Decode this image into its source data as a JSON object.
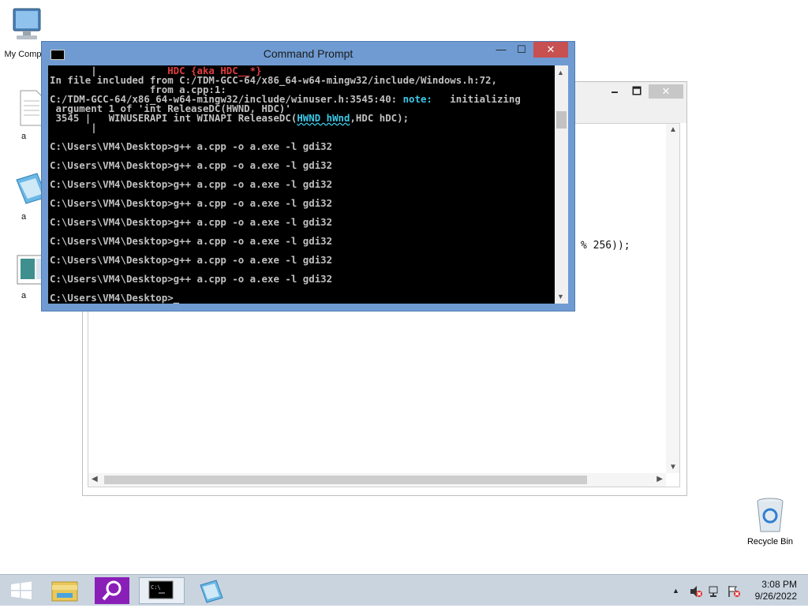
{
  "desktop": {
    "icons": [
      {
        "label": "My Comp",
        "icon": "computer-icon"
      },
      {
        "label": "a",
        "icon": "text-file-icon"
      },
      {
        "label": "a",
        "icon": "notepad-file-icon"
      },
      {
        "label": "a",
        "icon": "image-file-icon"
      }
    ],
    "recycle_bin": {
      "label": "Recycle Bin",
      "icon": "recycle-bin-icon"
    }
  },
  "background_window": {
    "minimize": "🗕",
    "maximize": "🗖",
    "close": "✕",
    "code_fragment": "% 256));"
  },
  "cmd_window": {
    "title": "Command Prompt",
    "minimize": "—",
    "maximize": "☐",
    "close": "✕",
    "lines": [
      {
        "segments": [
          {
            "text": "       |            ",
            "color": "normal"
          },
          {
            "text": "HDC {aka HDC__*}",
            "color": "red"
          }
        ]
      },
      {
        "segments": [
          {
            "text": "In file included from ",
            "color": "normal"
          },
          {
            "text": "C:/TDM-GCC-64/x86_64-w64-mingw32/include/Windows.h:72,",
            "color": "normal"
          }
        ]
      },
      {
        "segments": [
          {
            "text": "                 from a.cpp:1:",
            "color": "normal"
          }
        ]
      },
      {
        "segments": [
          {
            "text": "C:/TDM-GCC-64/x86_64-w64-mingw32/include/winuser.h:3545:40: ",
            "color": "normal"
          },
          {
            "text": "note:",
            "color": "cyan"
          },
          {
            "text": "   initializing",
            "color": "normal"
          }
        ]
      },
      {
        "segments": [
          {
            "text": " argument 1 of 'int ReleaseDC(HWND, HDC)'",
            "color": "normal"
          }
        ]
      },
      {
        "segments": [
          {
            "text": " 3545 |   WINUSERAPI int WINAPI ReleaseDC(",
            "color": "normal"
          },
          {
            "text": "HWND hWnd",
            "color": "cyan-wave"
          },
          {
            "text": ",HDC hDC);",
            "color": "normal"
          }
        ]
      },
      {
        "segments": [
          {
            "text": "       |",
            "color": "normal"
          }
        ]
      },
      {
        "segments": [
          {
            "text": "",
            "color": "normal"
          }
        ]
      },
      {
        "segments": [
          {
            "text": "C:\\Users\\VM4\\Desktop>g++ a.cpp -o a.exe -l gdi32",
            "color": "normal"
          }
        ]
      },
      {
        "segments": [
          {
            "text": "",
            "color": "normal"
          }
        ]
      },
      {
        "segments": [
          {
            "text": "C:\\Users\\VM4\\Desktop>g++ a.cpp -o a.exe -l gdi32",
            "color": "normal"
          }
        ]
      },
      {
        "segments": [
          {
            "text": "",
            "color": "normal"
          }
        ]
      },
      {
        "segments": [
          {
            "text": "C:\\Users\\VM4\\Desktop>g++ a.cpp -o a.exe -l gdi32",
            "color": "normal"
          }
        ]
      },
      {
        "segments": [
          {
            "text": "",
            "color": "normal"
          }
        ]
      },
      {
        "segments": [
          {
            "text": "C:\\Users\\VM4\\Desktop>g++ a.cpp -o a.exe -l gdi32",
            "color": "normal"
          }
        ]
      },
      {
        "segments": [
          {
            "text": "",
            "color": "normal"
          }
        ]
      },
      {
        "segments": [
          {
            "text": "C:\\Users\\VM4\\Desktop>g++ a.cpp -o a.exe -l gdi32",
            "color": "normal"
          }
        ]
      },
      {
        "segments": [
          {
            "text": "",
            "color": "normal"
          }
        ]
      },
      {
        "segments": [
          {
            "text": "C:\\Users\\VM4\\Desktop>g++ a.cpp -o a.exe -l gdi32",
            "color": "normal"
          }
        ]
      },
      {
        "segments": [
          {
            "text": "",
            "color": "normal"
          }
        ]
      },
      {
        "segments": [
          {
            "text": "C:\\Users\\VM4\\Desktop>g++ a.cpp -o a.exe -l gdi32",
            "color": "normal"
          }
        ]
      },
      {
        "segments": [
          {
            "text": "",
            "color": "normal"
          }
        ]
      },
      {
        "segments": [
          {
            "text": "C:\\Users\\VM4\\Desktop>g++ a.cpp -o a.exe -l gdi32",
            "color": "normal"
          }
        ]
      },
      {
        "segments": [
          {
            "text": "",
            "color": "normal"
          }
        ]
      },
      {
        "segments": [
          {
            "text": "C:\\Users\\VM4\\Desktop>_",
            "color": "normal"
          }
        ]
      }
    ]
  },
  "taskbar": {
    "items": [
      {
        "name": "start-button",
        "icon": "windows-logo-icon"
      },
      {
        "name": "file-explorer-button",
        "icon": "folder-icon"
      },
      {
        "name": "search-app-button",
        "icon": "magnifier-icon"
      },
      {
        "name": "command-prompt-button",
        "icon": "cmd-icon"
      },
      {
        "name": "notepad-button",
        "icon": "notepad-icon"
      }
    ],
    "tray": {
      "show_hidden": "▲",
      "time": "3:08 PM",
      "date": "9/26/2022"
    }
  },
  "colors": {
    "cmd_frame": "#6f9bd2",
    "cmd_close": "#c75050",
    "console_text": "#c0c0c0",
    "console_red": "#e03c3c",
    "console_cyan": "#3cc8e8",
    "taskbar": "#c9d4df"
  }
}
